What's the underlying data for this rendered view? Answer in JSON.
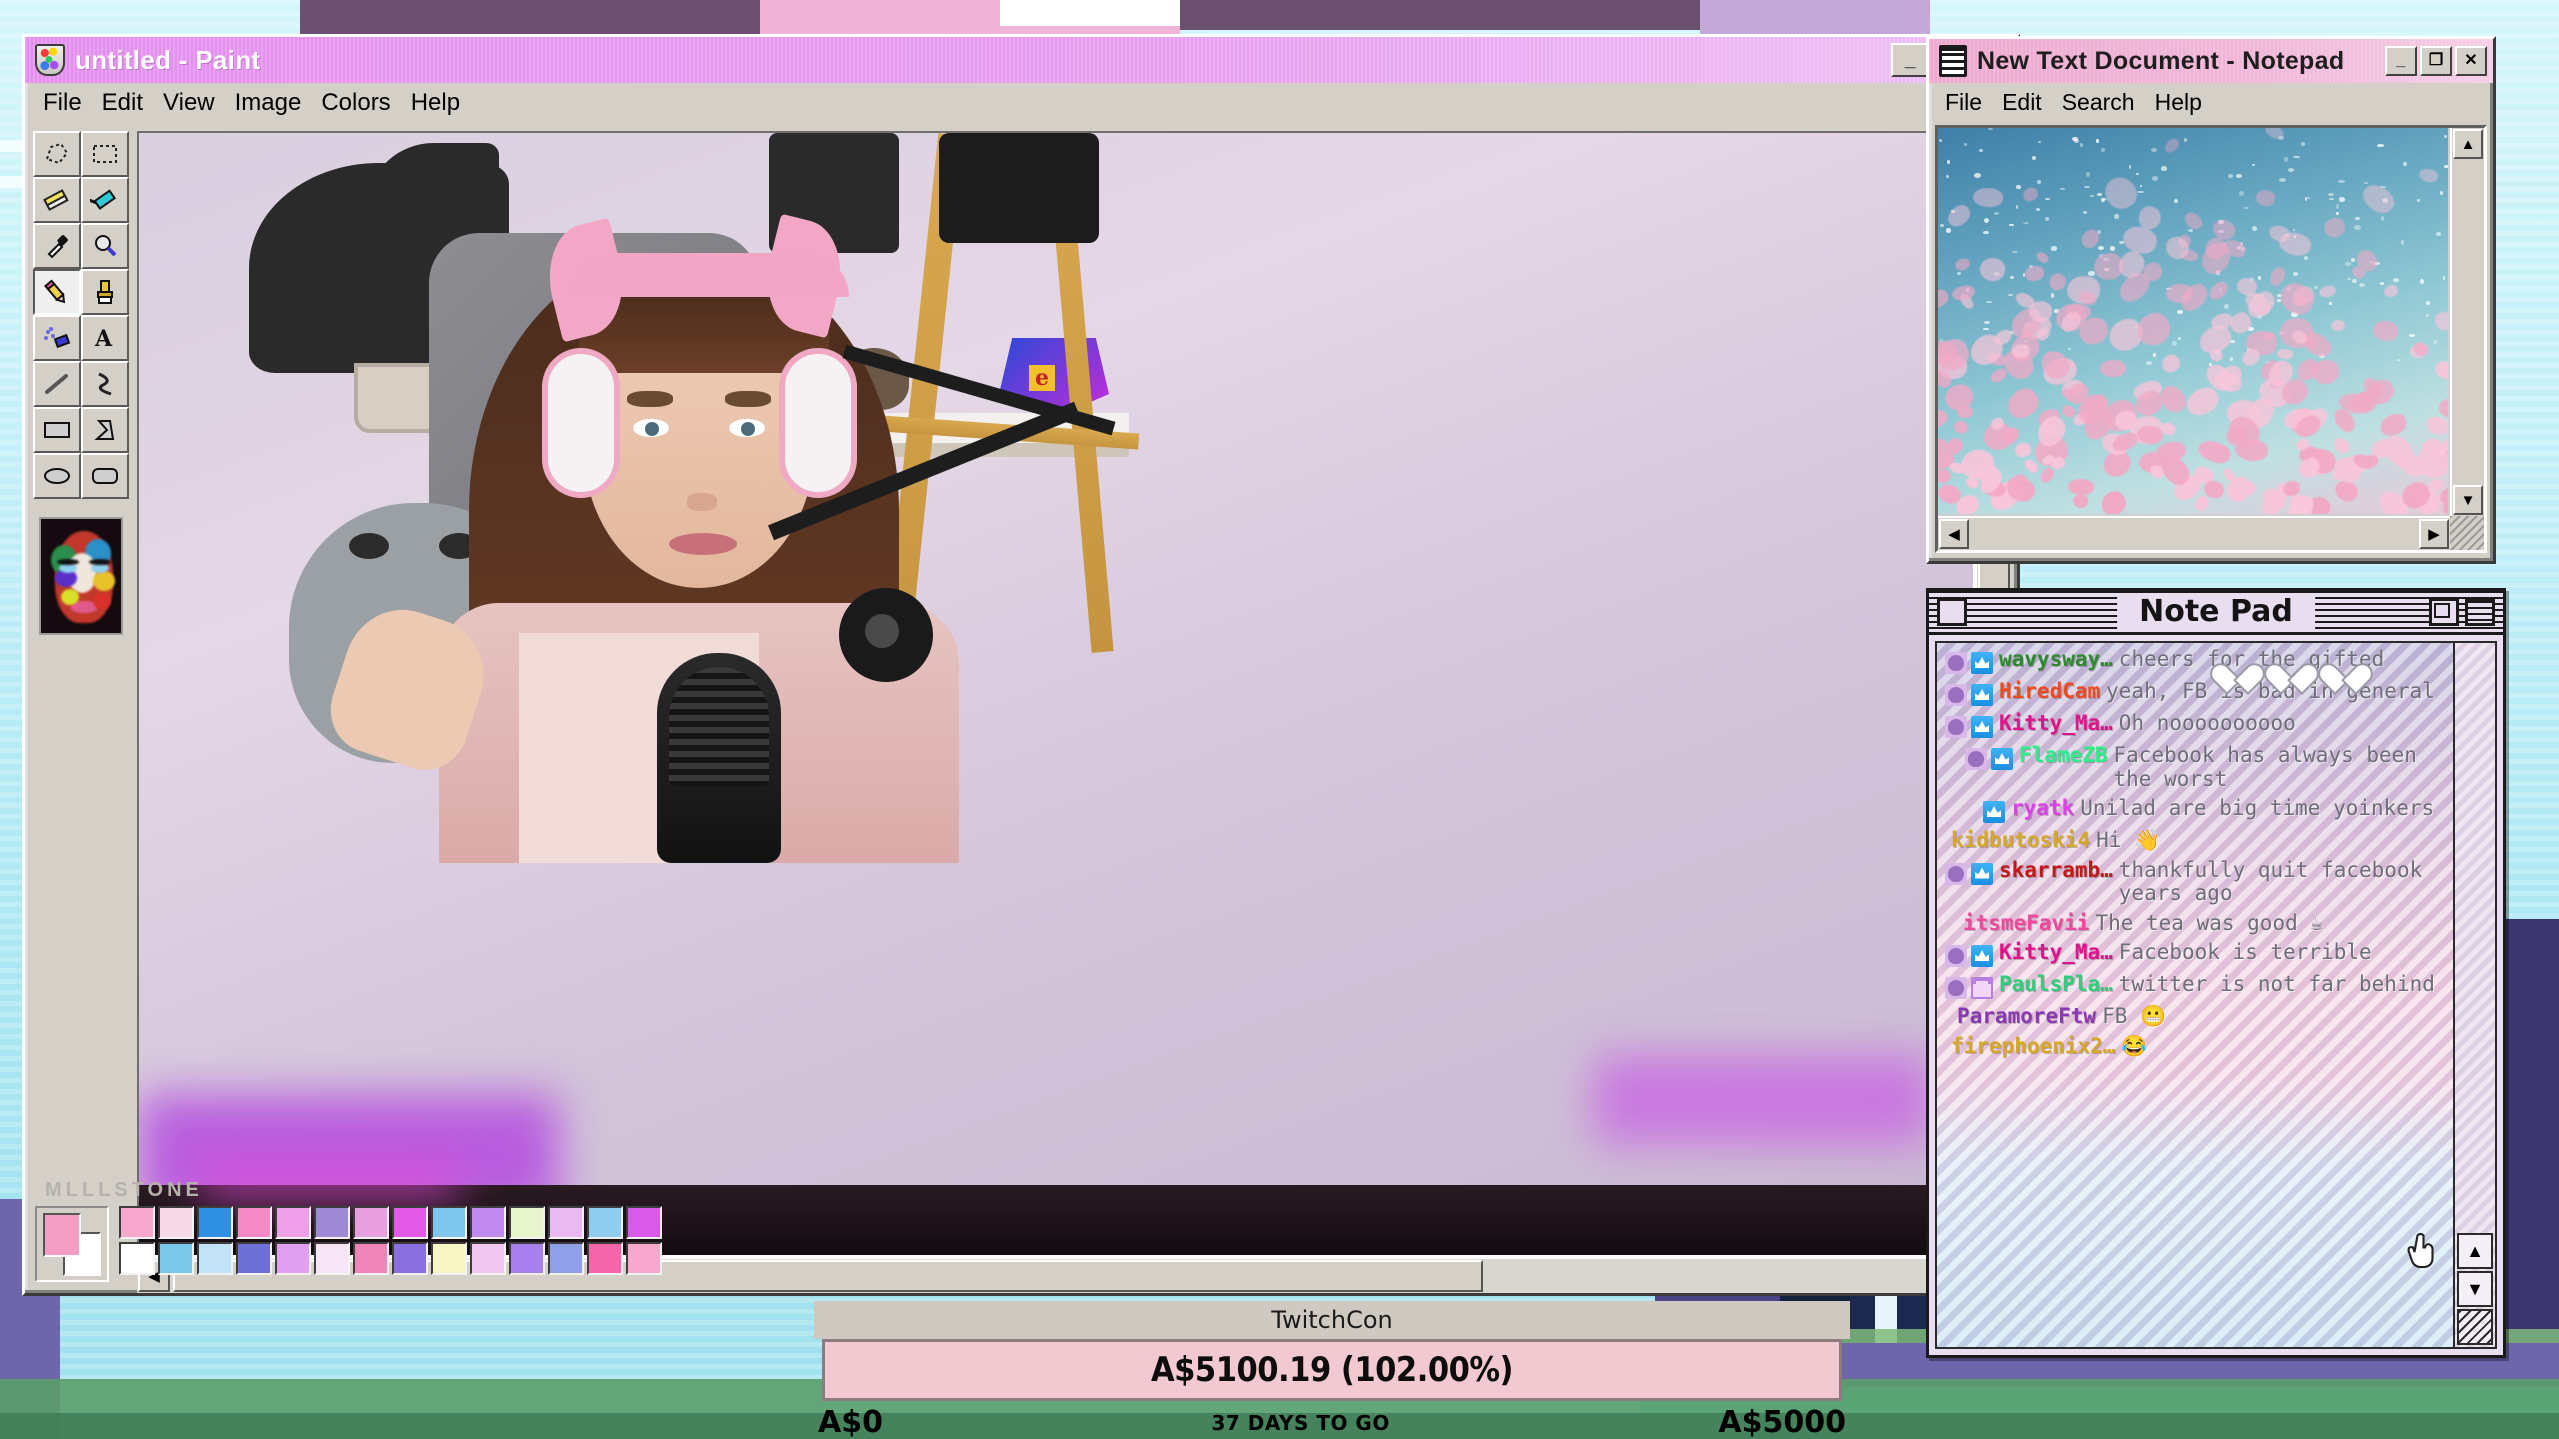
{
  "paint": {
    "title": "untitled - Paint",
    "icon": "paint-palette-icon",
    "menus": [
      "File",
      "Edit",
      "View",
      "Image",
      "Colors",
      "Help"
    ],
    "window_buttons": {
      "minimize": "_",
      "maximize": "❐",
      "close": "✕"
    },
    "tools": [
      "free-form-select-tool",
      "rectangle-select-tool",
      "eraser-tool",
      "fill-tool",
      "color-picker-tool",
      "magnifier-tool",
      "pencil-tool",
      "brush-tool",
      "airbrush-tool",
      "text-tool",
      "line-tool",
      "curve-tool",
      "rectangle-tool",
      "polygon-tool",
      "ellipse-tool",
      "rounded-rectangle-tool"
    ],
    "selected_tool": "pencil-tool",
    "watermark": "MLLLSTONE",
    "foreground_color": "#f59ec4",
    "background_color": "#ffffff",
    "palette_row1": [
      "#f7a8cc",
      "#f6d9e6",
      "#2f8fe0",
      "#f58ac4",
      "#ef9fe8",
      "#9f8ad6",
      "#e79fe0",
      "#e45ae8",
      "#7fc6ef",
      "#c08af0",
      "#e8f5cd",
      "#eab9f0",
      "#8fcdf0",
      "#d95ae8"
    ],
    "palette_row2": [
      "#ffffff",
      "#79c8ea",
      "#c2e2f7",
      "#6f6fd8",
      "#e0a0ef",
      "#f7e4f5",
      "#f086b8",
      "#8a6fe0",
      "#f7f5c4",
      "#f0c8ef",
      "#a87fef",
      "#8f9fe8",
      "#f567a8",
      "#f7a8cc"
    ]
  },
  "notepad": {
    "title": "New Text Document - Notepad",
    "icon": "notepad-icon",
    "menus": [
      "File",
      "Edit",
      "Search",
      "Help"
    ],
    "window_buttons": {
      "minimize": "_",
      "maximize": "❐",
      "close": "✕"
    },
    "content_description": "cherry-blossom-petals-image"
  },
  "chat_window": {
    "title": "Note Pad",
    "left_box": "close-box",
    "right_boxes": [
      "zoom-box",
      "windowshade-box"
    ],
    "messages": [
      {
        "badges": [
          "mod",
          "sub"
        ],
        "name": "wavysway…",
        "color": "#2f8a2f",
        "text": "cheers for the gifted",
        "indent": 0
      },
      {
        "badges": [
          "mod",
          "sub"
        ],
        "name": "HiredCam",
        "color": "#f04a1e",
        "text": "yeah, FB is bad in general",
        "indent": 0
      },
      {
        "badges": [
          "mod",
          "sub"
        ],
        "name": "Kitty_Ma…",
        "color": "#e0128c",
        "text": "Oh noooooooooo",
        "indent": 0
      },
      {
        "badges": [
          "mod",
          "sub"
        ],
        "name": "FlameZB",
        "color": "#2bf08a",
        "text": "Facebook has always been the worst",
        "indent": 20
      },
      {
        "badges": [
          "sub"
        ],
        "name": "ryatk",
        "color": "#e040e8",
        "text": "Unilad are big time yoinkers",
        "indent": 38
      },
      {
        "badges": [],
        "name": "kidbutoski4",
        "color": "#d6a828",
        "text": "Hi 👋",
        "indent": 0
      },
      {
        "badges": [
          "mod",
          "sub"
        ],
        "name": "skarramb…",
        "color": "#c21a1a",
        "text": "thankfully quit facebook years ago",
        "indent": 0
      },
      {
        "badges": [],
        "name": "itsmeFavii",
        "color": "#f0489c",
        "text": "The tea was good ☕",
        "indent": 12
      },
      {
        "badges": [
          "mod",
          "sub"
        ],
        "name": "Kitty_Ma…",
        "color": "#e0128c",
        "text": "Facebook is terrible",
        "indent": 0
      },
      {
        "badges": [
          "mod",
          "gift"
        ],
        "name": "PaulsPla…",
        "color": "#2bd07a",
        "text": "twitter is not far behind",
        "indent": 0
      },
      {
        "badges": [],
        "name": "ParamoreFtw",
        "color": "#8a3ab0",
        "text": "FB 😬",
        "indent": 6
      },
      {
        "badges": [],
        "name": "firephoenix2…",
        "color": "#d6a828",
        "text": "😂",
        "indent": 0
      }
    ],
    "reaction_hearts": 3,
    "scroll_up": "▲",
    "scroll_down": "▼",
    "resize_grip": "resize-grip"
  },
  "donation_bar": {
    "event_label": "TwitchCon",
    "value_label": "A$5100.19 (102.00%)",
    "min_label": "A$0",
    "max_label": "A$5000",
    "countdown_label": "37 DAYS TO GO",
    "percent": 102,
    "fill_color": "#f2c9d0"
  }
}
